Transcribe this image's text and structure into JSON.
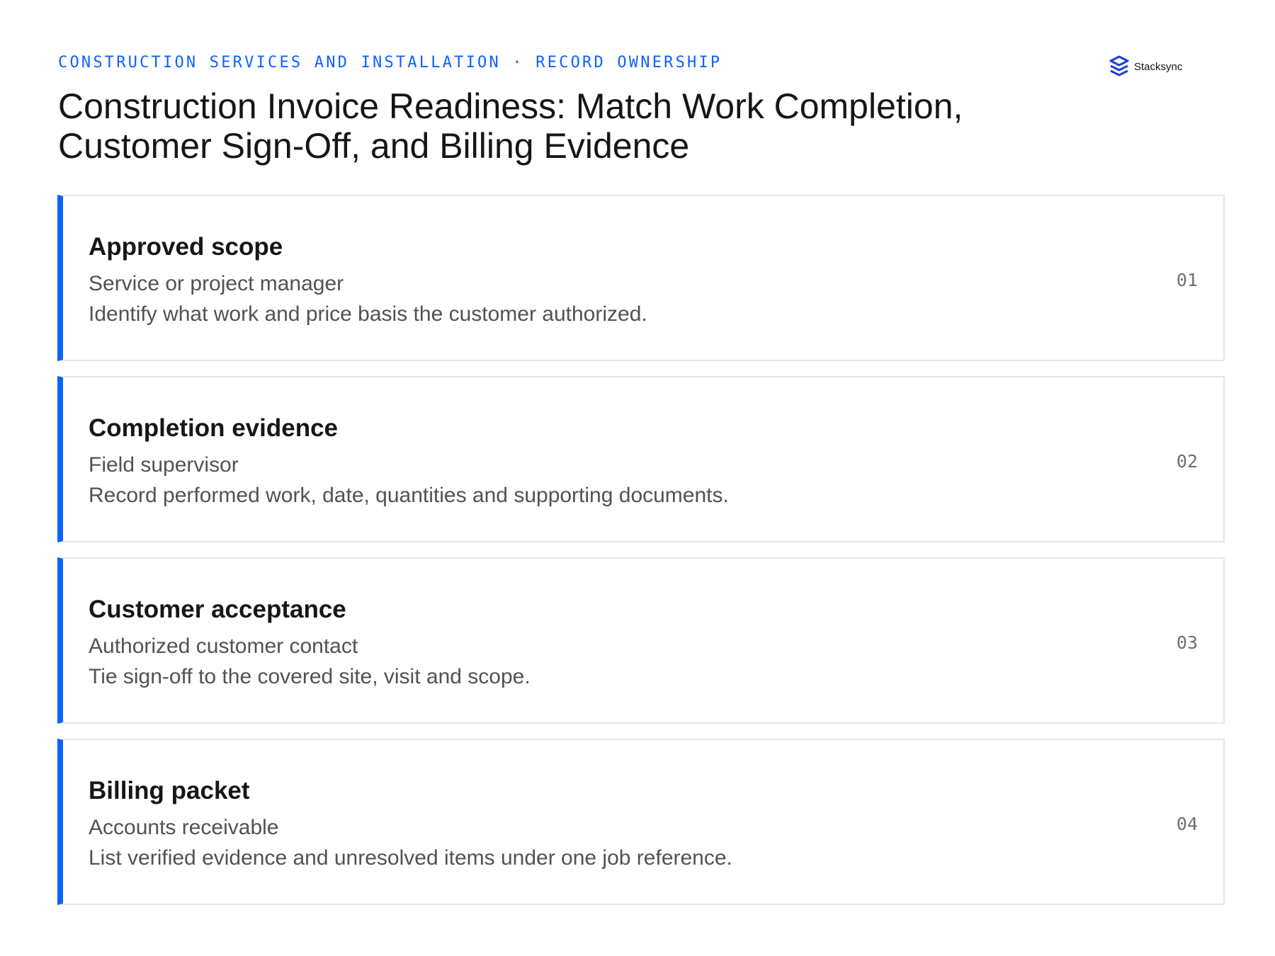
{
  "header": {
    "eyebrow": "CONSTRUCTION SERVICES AND INSTALLATION · RECORD OWNERSHIP",
    "title": "Construction Invoice Readiness: Match Work Completion, Customer Sign-Off, and Billing Evidence",
    "logo": {
      "icon": "stacksync-logo-icon",
      "text": "Stacksync",
      "color": "#1f3fd6"
    }
  },
  "colors": {
    "accent": "#0f62fe",
    "card_border": "#e6e6e6",
    "title_text": "#161616",
    "body_text": "#525252",
    "number_text": "#6f6f6f"
  },
  "cards": [
    {
      "title": "Approved scope",
      "owner": "Service or project manager",
      "description": "Identify what work and price basis the customer authorized.",
      "number": "01"
    },
    {
      "title": "Completion evidence",
      "owner": "Field supervisor",
      "description": "Record performed work, date, quantities and supporting documents.",
      "number": "02"
    },
    {
      "title": "Customer acceptance",
      "owner": "Authorized customer contact",
      "description": "Tie sign-off to the covered site, visit and scope.",
      "number": "03"
    },
    {
      "title": "Billing packet",
      "owner": "Accounts receivable",
      "description": "List verified evidence and unresolved items under one job reference.",
      "number": "04"
    }
  ]
}
